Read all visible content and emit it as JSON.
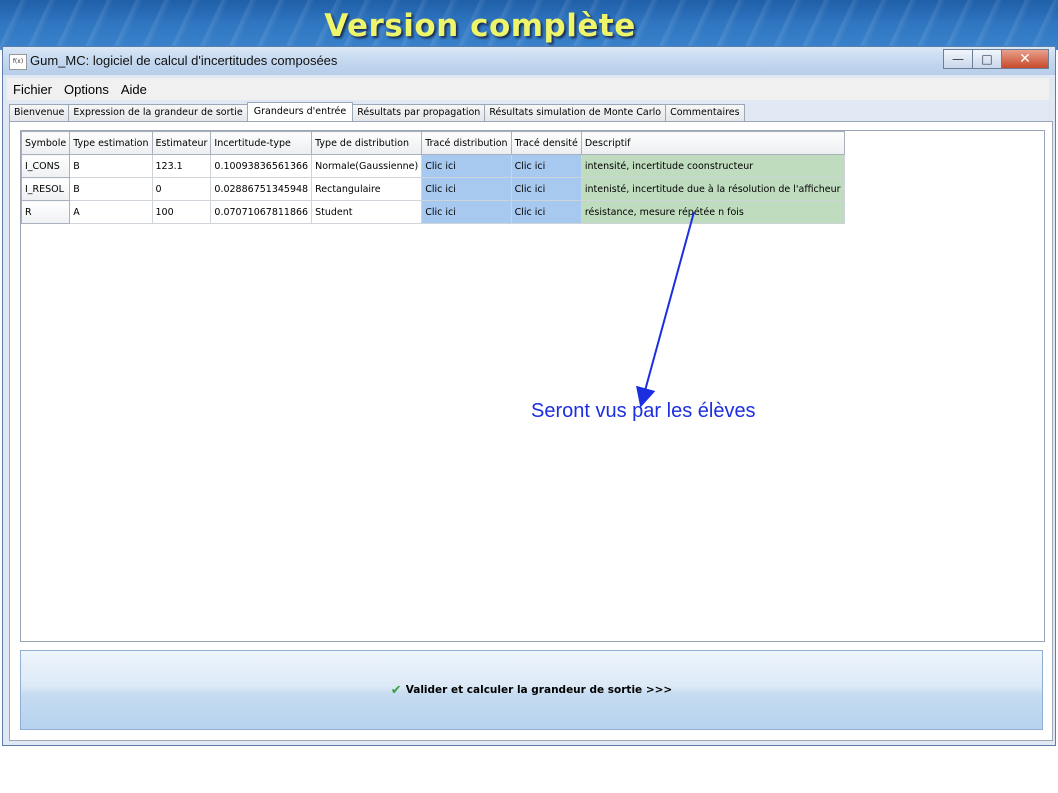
{
  "banner": {
    "title": "Version complète"
  },
  "window": {
    "title": "Gum_MC: logiciel de calcul d'incertitudes composées",
    "icon_text": "f(x)",
    "buttons": {
      "minimize": "—",
      "maximize": "□",
      "close": "✕"
    }
  },
  "menu": [
    "Fichier",
    "Options",
    "Aide"
  ],
  "tabs": [
    {
      "label": "Bienvenue",
      "active": false
    },
    {
      "label": "Expression de la grandeur de sortie",
      "active": false
    },
    {
      "label": "Grandeurs d'entrée",
      "active": true
    },
    {
      "label": "Résultats par propagation",
      "active": false
    },
    {
      "label": "Résultats simulation de Monte Carlo",
      "active": false
    },
    {
      "label": "Commentaires",
      "active": false
    }
  ],
  "table": {
    "headers": [
      "Symbole",
      "Type estimation",
      "Estimateur",
      "Incertitude-type",
      "Type de distribution",
      "Tracé distribution",
      "Tracé densité",
      "Descriptif"
    ],
    "rows": [
      [
        "I_CONS",
        "B",
        "123.1",
        "0.10093836561366",
        "Normale(Gaussienne)",
        "Clic ici",
        "Clic ici",
        "intensité, incertitude coonstructeur"
      ],
      [
        "I_RESOL",
        "B",
        "0",
        "0.02886751345948",
        "Rectangulaire",
        "Clic ici",
        "Clic ici",
        "intenisté, incertitude due à la résolution de l'afficheur"
      ],
      [
        "R",
        "A",
        "100",
        "0.07071067811866",
        "Student",
        "Clic ici",
        "Clic ici",
        "résistance, mesure répétée n fois"
      ]
    ],
    "colors": {
      "link_cell": "#a8c9ef",
      "desc_cell": "#bfdcbf"
    }
  },
  "action_button": {
    "label": "Valider et calculer la grandeur de sortie >>>",
    "icon": "check-icon"
  },
  "annotation": {
    "text": "Seront vus par les élèves",
    "color": "#1c2fe0"
  }
}
